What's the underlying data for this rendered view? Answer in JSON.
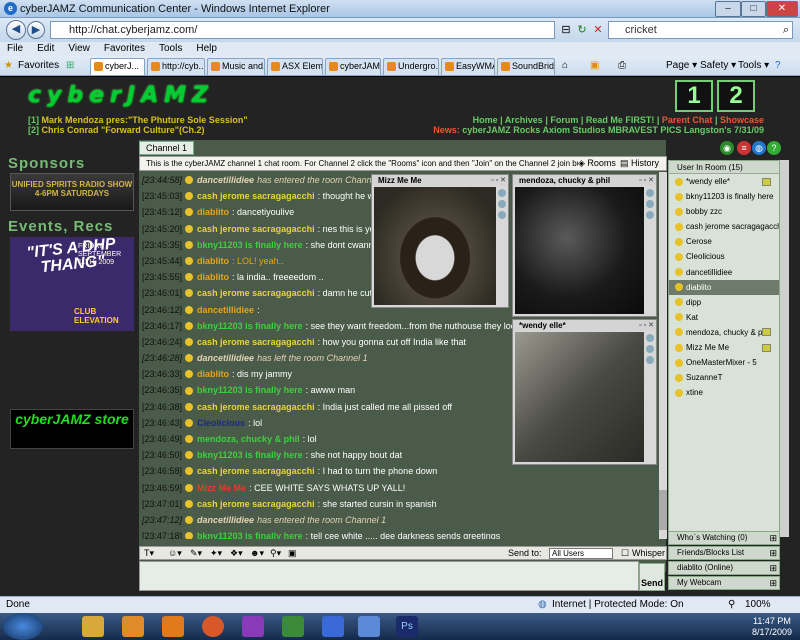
{
  "browser": {
    "title": "cyberJAMZ Communication Center - Windows Internet Explorer",
    "url": "http://chat.cyberjamz.com/",
    "search_value": "cricket",
    "menu": [
      "File",
      "Edit",
      "View",
      "Favorites",
      "Tools",
      "Help"
    ],
    "favorites_label": "Favorites",
    "tabs": [
      "cyberJ...",
      "http://cyb...",
      "Music and...",
      "ASX Eleme...",
      "cyberJAM...",
      "Undergro...",
      "EasyWMA",
      "SoundBrid..."
    ],
    "toolbar": [
      "Page ▾",
      "Safety ▾",
      "Tools ▾"
    ],
    "status_left": "Done",
    "status_zone": "Internet | Protected Mode: On",
    "zoom": "100%"
  },
  "site": {
    "logo": "cyberJAMZ",
    "channel_buttons": [
      "1",
      "2"
    ],
    "now_playing": [
      {
        "num": "[1]",
        "text": "Mark Mendoza pres:\"The Phuture Sole Session\""
      },
      {
        "num": "[2]",
        "text": "Chris Conrad \"Forward Culture\"(Ch.2)"
      }
    ],
    "nav_line1": [
      "Home",
      "Archives",
      "Forum",
      "Read Me FIRST!",
      "Parent Chat",
      "Showcase"
    ],
    "nav_line2_prefix": "News:",
    "nav_line2": "cyberJAMZ Rocks Axiom Studios  MBRAVEST PICS  Langston's 7/31/09",
    "sponsors_heading": "Sponsors",
    "sponsor_banner": "UNIFIED SPIRITS RADIO SHOW 4-6PM SATURDAYS",
    "events_heading": "Events, Recs",
    "event_banner_big": "\"IT'S A DHP THANG\"",
    "event_banner_small": "FRIDAY SEPTEMBER 11TH, 2009",
    "event_banner_club": "CLUB ELEVATION",
    "store_label": "cyberJAMZ store"
  },
  "chat": {
    "tab_label": "Channel 1",
    "info": "This is the cyberJAMZ channel 1 chat room. For Channel 2 click the \"Rooms\" icon and then \"Join\" on the Channel 2 join button ->",
    "rooms_label": "Rooms",
    "history_label": "History",
    "messages": [
      {
        "ts": "[23:44:58]",
        "user": "dancetillidiee",
        "text": "has entered the room Channel 1",
        "color": "#e4d4b4",
        "sys": true
      },
      {
        "ts": "[23:45:03]",
        "user": "cash jerome sacragagacchi",
        "text": ": thought he was singin",
        "color": "#e8d43a",
        "sys": false
      },
      {
        "ts": "[23:45:12]",
        "user": "diablito",
        "text": ": dancetiyoulive",
        "color": "#e8a21a",
        "sys": false
      },
      {
        "ts": "[23:45:20]",
        "user": "cash jerome sacragagacchi",
        "text": ": nes this is your song",
        "color": "#e8d43a",
        "sys": false
      },
      {
        "ts": "[23:45:35]",
        "user": "bkny11203 is finally here",
        "text": ": she dont cwanna come",
        "color": "#3ecf3e",
        "sys": false
      },
      {
        "ts": "[23:45:44]",
        "user": "diablito",
        "text": ": LOL! yeah..",
        "color": "#e8a21a",
        "sys": false
      },
      {
        "ts": "[23:45:55]",
        "user": "diablito",
        "text": ": la india.. freeeedom ..",
        "color": "#e8a21a",
        "sys": false
      },
      {
        "ts": "[23:46:01]",
        "user": "cash jerome sacragagacchi",
        "text": ": damn he cut out of th",
        "color": "#e8d43a",
        "sys": false
      },
      {
        "ts": "[23:46:12]",
        "user": "dancetillidiee",
        "text": ":",
        "color": "#e8a21a",
        "sys": false
      },
      {
        "ts": "[23:46:17]",
        "user": "bkny11203 is finally here",
        "text": ": see they want freedom...from the nuthouse they locked up in",
        "color": "#3ecf3e",
        "sys": false
      },
      {
        "ts": "[23:46:24]",
        "user": "cash jerome sacragagacchi",
        "text": ": how you gonna cut off India like that",
        "color": "#e8d43a",
        "sys": false
      },
      {
        "ts": "[23:46:28]",
        "user": "dancetillidiee",
        "text": "has left the room Channel 1",
        "color": "#e4d4b4",
        "sys": true
      },
      {
        "ts": "[23:46:33]",
        "user": "diablito",
        "text": ": dis my jammy",
        "color": "#e8a21a",
        "sys": false
      },
      {
        "ts": "[23:46:35]",
        "user": "bkny11203 is finally here",
        "text": ": awww man",
        "color": "#3ecf3e",
        "sys": false
      },
      {
        "ts": "[23:46:38]",
        "user": "cash jerome sacragagacchi",
        "text": ": India just called me all pissed off",
        "color": "#e8d43a",
        "sys": false
      },
      {
        "ts": "[23:46:43]",
        "user": "Cleolicious",
        "text": ": lol",
        "color": "#1a2a7a",
        "sys": false
      },
      {
        "ts": "[23:46:49]",
        "user": "mendoza, chucky & phil",
        "text": ": lol",
        "color": "#3ecf3e",
        "sys": false
      },
      {
        "ts": "[23:46:50]",
        "user": "bkny11203 is finally here",
        "text": ": she not happy bout dat",
        "color": "#3ecf3e",
        "sys": false
      },
      {
        "ts": "[23:46:58]",
        "user": "cash jerome sacragagacchi",
        "text": ": I had to turn the phone down",
        "color": "#e8d43a",
        "sys": false
      },
      {
        "ts": "[23:46:59]",
        "user": "Mizz Me Me",
        "text": ": CEE WHITE SAYS WHATS UP YALL!",
        "color": "#e83a2a",
        "sys": false
      },
      {
        "ts": "[23:47:01]",
        "user": "cash jerome sacragagacchi",
        "text": ": she started cursin in spanish",
        "color": "#e8d43a",
        "sys": false
      },
      {
        "ts": "[23:47:12]",
        "user": "dancetillidiee",
        "text": "has entered the room Channel 1",
        "color": "#e4d4b4",
        "sys": true
      },
      {
        "ts": "[23:47:18]",
        "user": "bkny11203 is finally here",
        "text": ": tell cee white ..... dee darkness sends greetings",
        "color": "#3ecf3e",
        "sys": false
      }
    ],
    "cams": [
      {
        "name": "Mizz Me Me"
      },
      {
        "name": "mendoza, chucky & phil"
      },
      {
        "name": "*wendy elle*"
      }
    ],
    "send_to_label": "Send to:",
    "send_to_value": "All Users",
    "whisper_label": "Whisper",
    "send_label": "Send"
  },
  "users": {
    "header": "User In Room (15)",
    "list": [
      "*wendy elle*",
      "bkny11203 is finally here",
      "bobby zzc",
      "cash jerome sacragagacchi",
      "Cerose",
      "Cleolicious",
      "dancetillidiee",
      "diablito",
      "dipp",
      "Kat",
      "mendoza, chucky & phil",
      "Mizz Me Me",
      "OneMasterMixer - 5",
      "SuzanneT",
      "xtine"
    ],
    "highlighted": 7,
    "panels": [
      "Who`s Watching (0)",
      "Friends/Blocks List",
      "diablito (Online)",
      "My Webcam"
    ]
  },
  "taskbar": {
    "time": "11:47 PM",
    "date": "8/17/2009"
  }
}
